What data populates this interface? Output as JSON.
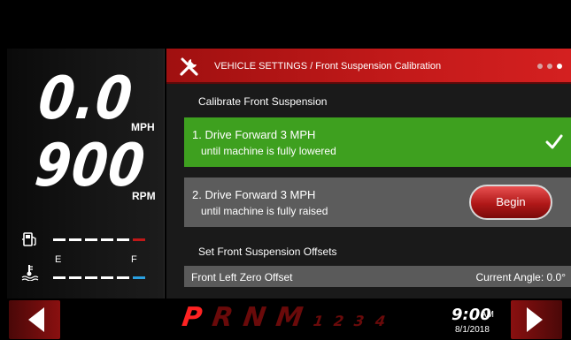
{
  "gauges": {
    "speed": "0.0",
    "speed_unit": "MPH",
    "rpm": "900",
    "rpm_unit": "RPM",
    "fuel_empty_label": "E",
    "fuel_full_label": "F"
  },
  "header": {
    "title": "VEHICLE SETTINGS / Front Suspension Calibration",
    "icon": "wrench-icon",
    "page_dots": 3,
    "active_dot": 3
  },
  "calibrate": {
    "section_label": "Calibrate Front Suspension",
    "step1_line1": "1. Drive Forward 3 MPH",
    "step1_line2": "until machine is fully lowered",
    "step1_done": true,
    "step2_line1": "2. Drive Forward 3 MPH",
    "step2_line2": "until machine is fully raised",
    "begin_label": "Begin"
  },
  "offsets": {
    "section_label": "Set Front Suspension Offsets",
    "row_label": "Front Left Zero Offset",
    "angle_label": "Current Angle: 0.0°"
  },
  "footer": {
    "gears": [
      "P",
      "R",
      "N",
      "M"
    ],
    "gear_numbers": [
      "1",
      "2",
      "3",
      "4"
    ],
    "active_gear": "P",
    "time": "9:00",
    "ampm": "AM",
    "date": "8/1/2018"
  },
  "colors": {
    "accent_red": "#c41a1a",
    "success_green": "#3ea01f",
    "row_gray": "#5c5c5c",
    "temp_blue": "#2aa0e0"
  }
}
